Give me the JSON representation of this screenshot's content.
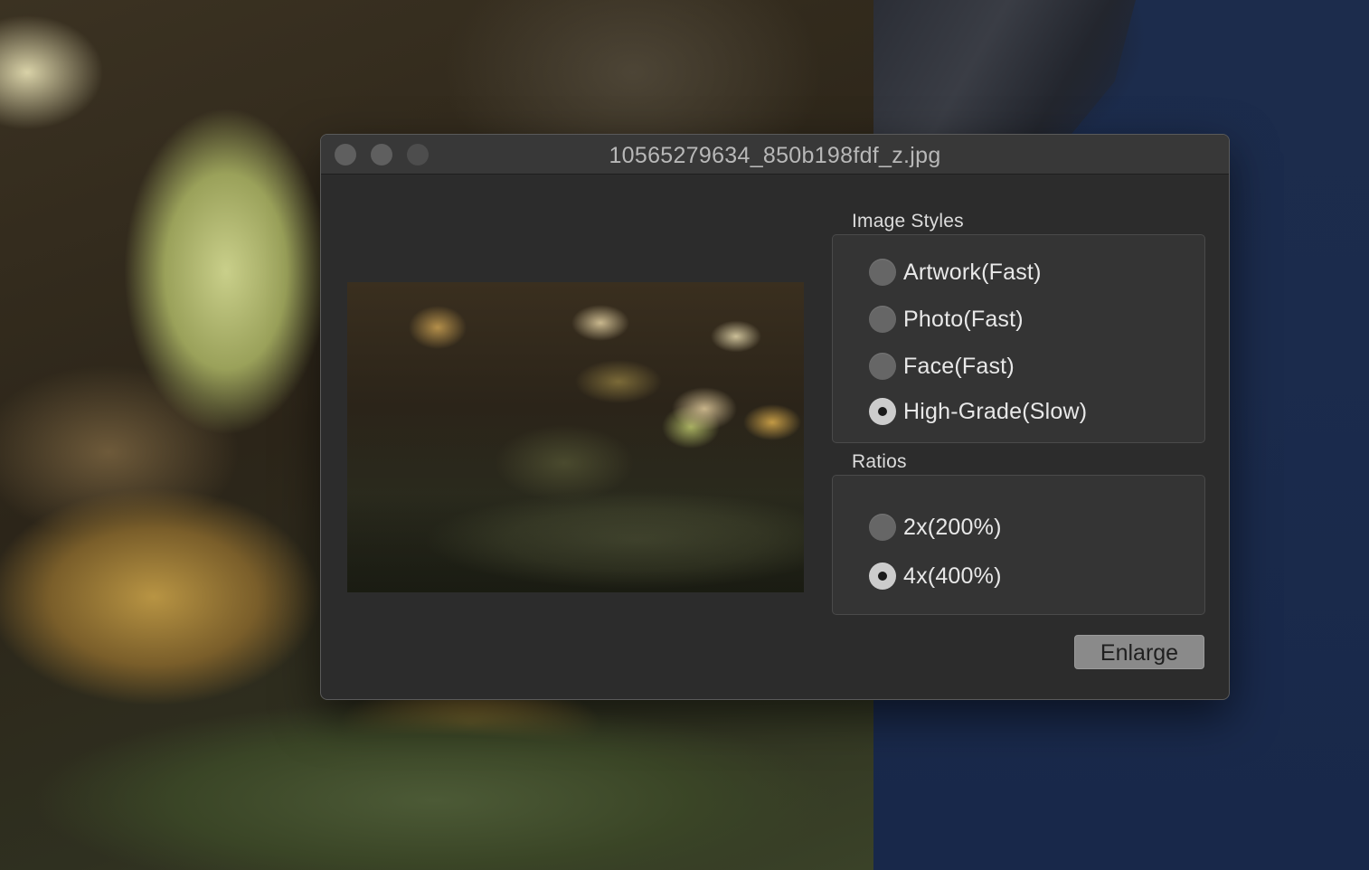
{
  "window": {
    "title": "10565279634_850b198fdf_z.jpg"
  },
  "image_styles": {
    "label": "Image Styles",
    "options": [
      {
        "label": "Artwork(Fast)",
        "selected": false
      },
      {
        "label": "Photo(Fast)",
        "selected": false
      },
      {
        "label": "Face(Fast)",
        "selected": false
      },
      {
        "label": "High-Grade(Slow)",
        "selected": true
      }
    ]
  },
  "ratios": {
    "label": "Ratios",
    "options": [
      {
        "label": "2x(200%)",
        "selected": false
      },
      {
        "label": "4x(400%)",
        "selected": true
      }
    ]
  },
  "actions": {
    "enlarge_label": "Enlarge"
  },
  "colors": {
    "window_bg": "#2c2c2c",
    "titlebar_bg": "#383838",
    "button_bg": "#8a8a8a"
  }
}
